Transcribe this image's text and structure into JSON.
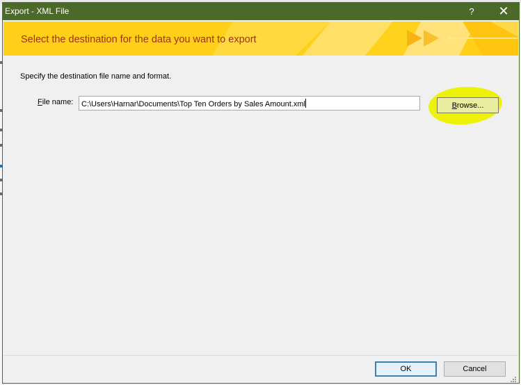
{
  "window": {
    "title": "Export - XML File",
    "help_glyph": "?",
    "close_glyph": "✕"
  },
  "banner": {
    "heading": "Select the destination for the data you want to export"
  },
  "form": {
    "instruction": "Specify the destination file name and format.",
    "file_label_accel": "F",
    "file_label_rest": "ile name:",
    "file_value": "C:\\Users\\Harnar\\Documents\\Top Ten Orders by Sales Amount.xml",
    "browse_accel": "B",
    "browse_rest": "rowse..."
  },
  "footer": {
    "ok_label": "OK",
    "cancel_label": "Cancel"
  },
  "colors": {
    "titlebar": "#4b6a2a",
    "banner": "#ffcf1a",
    "banner_text": "#9a3414",
    "highlight": "#eef20a",
    "default_button_border": "#3c7fb1"
  },
  "icons": {
    "help": "question-mark-icon",
    "close": "close-icon",
    "grip": "resize-grip-icon"
  }
}
